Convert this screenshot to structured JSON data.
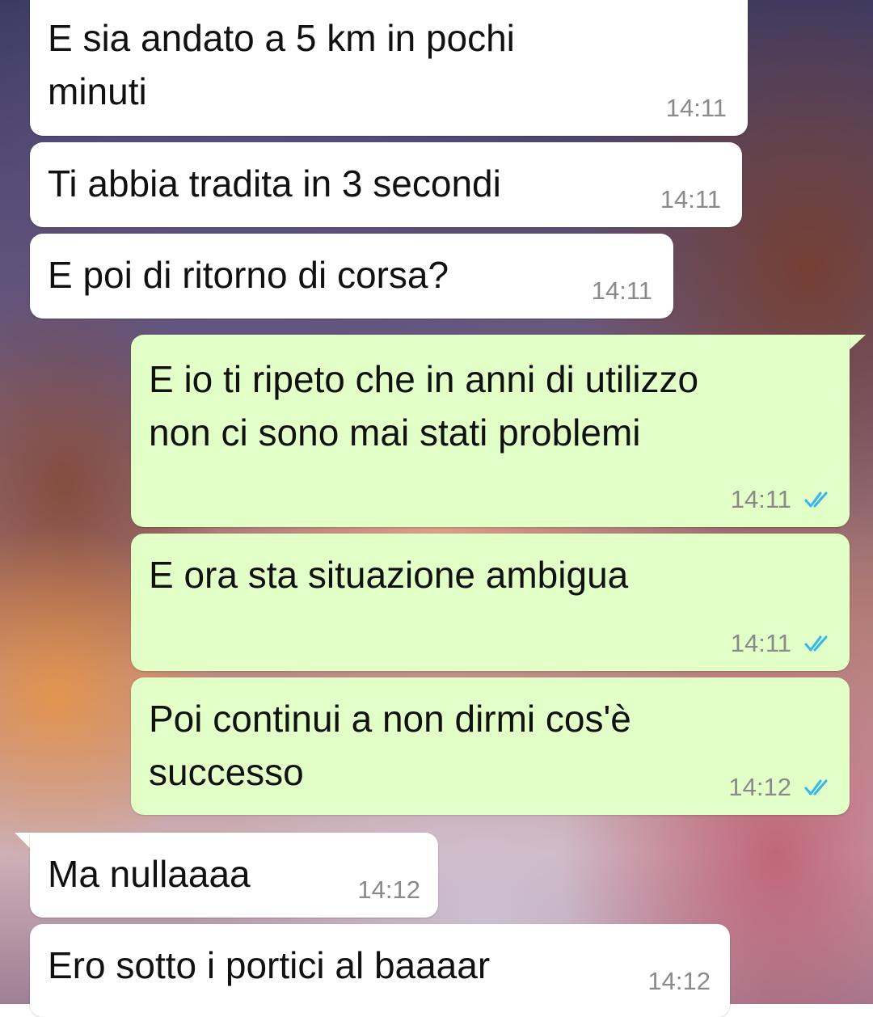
{
  "chat": {
    "messages": [
      {
        "direction": "in",
        "text": "E sia andato a 5 km in pochi\nminuti",
        "time": "14:11"
      },
      {
        "direction": "in",
        "text": "Ti abbia tradita in 3 secondi",
        "time": "14:11"
      },
      {
        "direction": "in",
        "text": "E poi di ritorno di corsa?",
        "time": "14:11"
      },
      {
        "direction": "out",
        "text": "E io ti ripeto che in anni di utilizzo\nnon ci sono mai stati problemi",
        "time": "14:11",
        "status_icon": "double-check-read-icon"
      },
      {
        "direction": "out",
        "text": "E ora sta situazione ambigua",
        "time": "14:11",
        "status_icon": "double-check-read-icon"
      },
      {
        "direction": "out",
        "text": "Poi continui a non dirmi cos'è\nsuccesso",
        "time": "14:12",
        "status_icon": "double-check-read-icon"
      },
      {
        "direction": "in",
        "text": "Ma nullaaaa",
        "time": "14:12"
      },
      {
        "direction": "in",
        "text": "Ero sotto i portici al baaaar",
        "time": "14:12"
      }
    ]
  },
  "colors": {
    "incoming_bubble": "#ffffff",
    "outgoing_bubble": "#e1ffc7",
    "timestamp": "#8a8a8a",
    "read_ticks": "#34b7f1"
  }
}
